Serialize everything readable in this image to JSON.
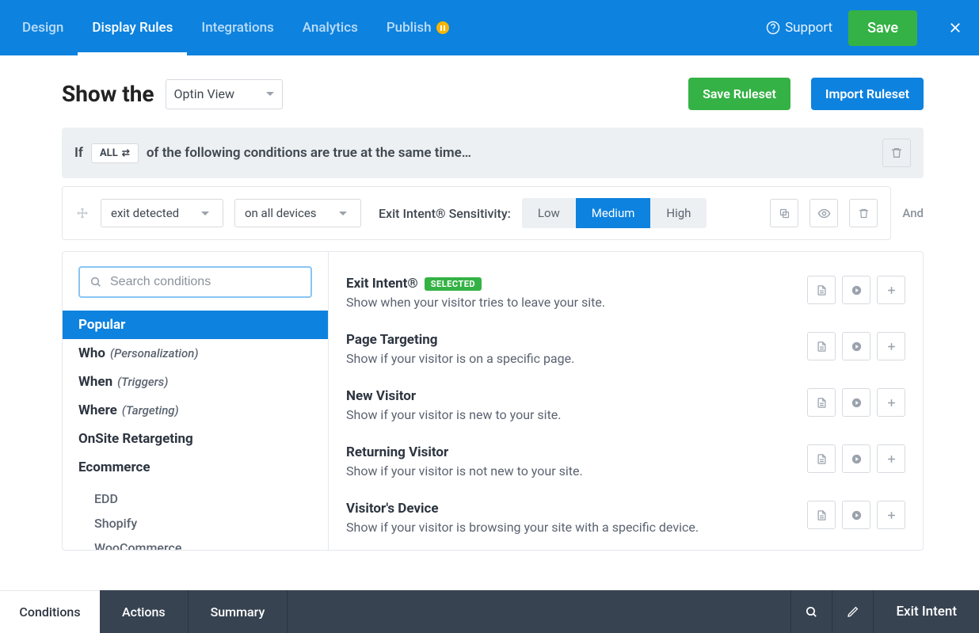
{
  "topnav": {
    "items": [
      "Design",
      "Display Rules",
      "Integrations",
      "Analytics",
      "Publish"
    ],
    "active_index": 1
  },
  "support_label": "Support",
  "save_label": "Save",
  "title": "Show the",
  "view_select": "Optin View",
  "buttons": {
    "save_ruleset": "Save Ruleset",
    "import_ruleset": "Import Ruleset"
  },
  "rule_bar": {
    "if": "If",
    "mode": "ALL",
    "rest": "of the following conditions are true at the same time…"
  },
  "cond": {
    "trigger": "exit detected",
    "device": "on all devices",
    "sens_label": "Exit Intent® Sensitivity:",
    "levels": [
      "Low",
      "Medium",
      "High"
    ],
    "active_level": 1,
    "and": "And"
  },
  "search_placeholder": "Search conditions",
  "categories": [
    {
      "label": "Popular",
      "sub": ""
    },
    {
      "label": "Who",
      "sub": "(Personalization)"
    },
    {
      "label": "When",
      "sub": "(Triggers)"
    },
    {
      "label": "Where",
      "sub": "(Targeting)"
    },
    {
      "label": "OnSite Retargeting",
      "sub": ""
    },
    {
      "label": "Ecommerce",
      "sub": ""
    }
  ],
  "ecom_children": [
    "EDD",
    "Shopify",
    "WooCommerce"
  ],
  "options": [
    {
      "title": "Exit Intent®",
      "selected": true,
      "desc": "Show when your visitor tries to leave your site."
    },
    {
      "title": "Page Targeting",
      "selected": false,
      "desc": "Show if your visitor is on a specific page."
    },
    {
      "title": "New Visitor",
      "selected": false,
      "desc": "Show if your visitor is new to your site."
    },
    {
      "title": "Returning Visitor",
      "selected": false,
      "desc": "Show if your visitor is not new to your site."
    },
    {
      "title": "Visitor's Device",
      "selected": false,
      "desc": "Show if your visitor is browsing your site with a specific device."
    }
  ],
  "selected_chip": "SELECTED",
  "bottom": {
    "left": "Conditions",
    "tabs": [
      "Actions",
      "Summary"
    ],
    "right": "Exit Intent"
  }
}
